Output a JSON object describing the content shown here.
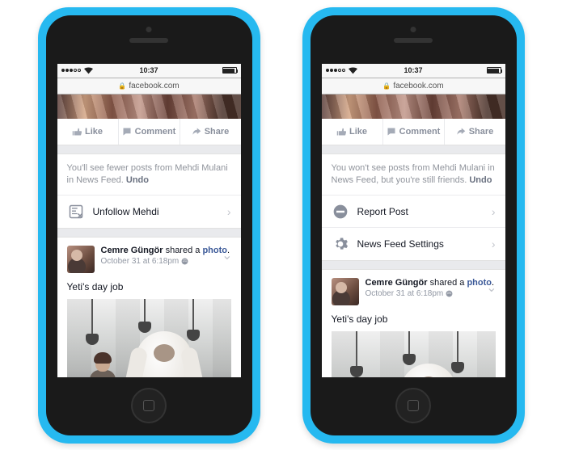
{
  "statusbar": {
    "time": "10:37",
    "wifi_name": "wifi-icon"
  },
  "url": "facebook.com",
  "actions": {
    "like": "Like",
    "comment": "Comment",
    "share": "Share"
  },
  "left": {
    "notice": "You'll see fewer posts from Mehdi Mulani in News Feed. ",
    "undo": "Undo",
    "rows": [
      {
        "icon": "unfollow-icon",
        "label": "Unfollow Mehdi"
      }
    ]
  },
  "right": {
    "notice": "You won't see posts from Mehdi Mulani in News Feed, but you're still friends. ",
    "undo": "Undo",
    "rows": [
      {
        "icon": "report-icon",
        "label": "Report Post"
      },
      {
        "icon": "settings-icon",
        "label": "News Feed Settings"
      }
    ]
  },
  "post": {
    "author": "Cemre Güngör",
    "verb": " shared a ",
    "object": "photo",
    "period": ".",
    "time": "October 31 at 6:18pm",
    "body": "Yeti's day job"
  }
}
